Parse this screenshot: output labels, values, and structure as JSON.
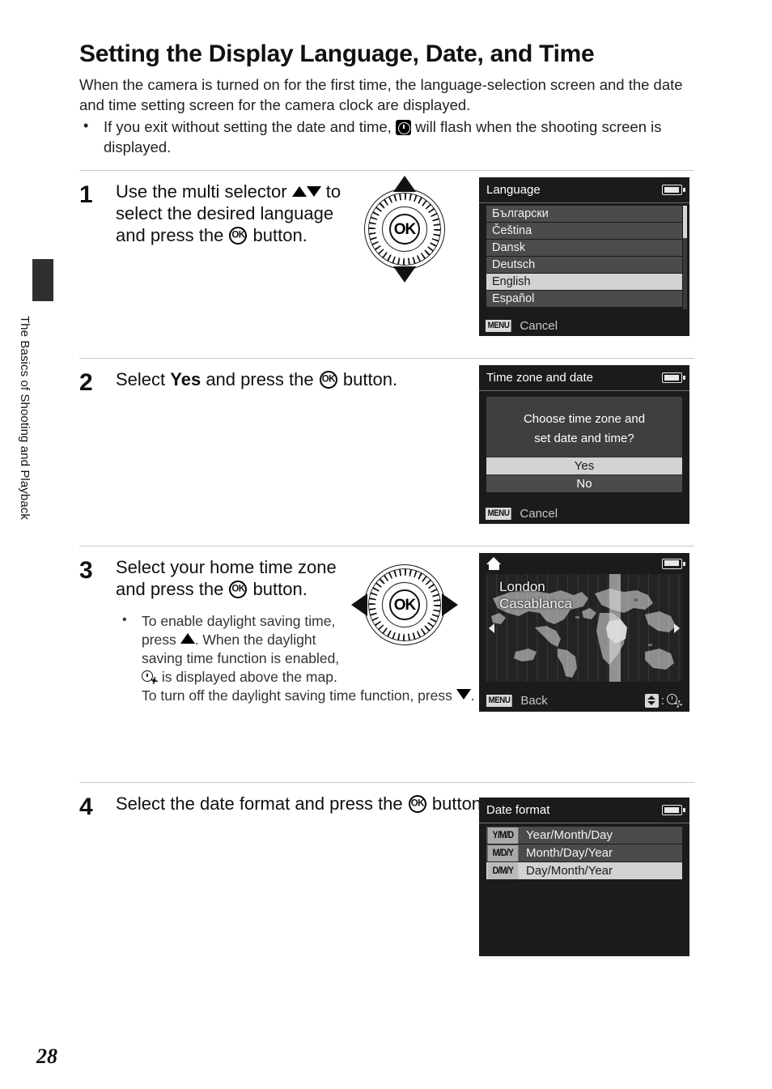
{
  "sidebar": {
    "chapter_label": "The Basics of Shooting and Playback"
  },
  "page": {
    "number": "28",
    "title": "Setting the Display Language, Date, and Time",
    "intro": "When the camera is turned on for the first time, the language-selection screen and the date and time setting screen for the camera clock are displayed.",
    "intro_bullet_pre": "If you exit without setting the date and time, ",
    "intro_bullet_post": " will flash when the shooting screen is displayed.",
    "bullet_marker": "•"
  },
  "steps": [
    {
      "number": "1",
      "text_pre": "Use the multi selector ",
      "text_mid": " to select the desired language and press the ",
      "text_post": " button.",
      "dial": {
        "arrows": "up-down",
        "ok_label": "OK"
      }
    },
    {
      "number": "2",
      "text_pre": "Select ",
      "bold": "Yes",
      "text_mid": " and press the ",
      "text_post": " button."
    },
    {
      "number": "3",
      "text_pre": "Select your home time zone and press the ",
      "text_post": " button.",
      "dial": {
        "arrows": "left-right",
        "ok_label": "OK"
      },
      "bullet_line1": "To enable daylight saving time, press ",
      "bullet_line2": ". When the daylight saving time function is enabled, ",
      "bullet_line3": " is displayed above the map.",
      "bullet_line4_pre": "To turn off the daylight saving time function, press ",
      "bullet_line4_post": "."
    },
    {
      "number": "4",
      "text_pre": "Select the date format and press the ",
      "text_post": " button."
    }
  ],
  "screens": {
    "language": {
      "title": "Language",
      "items": [
        {
          "label": "Български",
          "selected": false
        },
        {
          "label": "Čeština",
          "selected": false
        },
        {
          "label": "Dansk",
          "selected": false
        },
        {
          "label": "Deutsch",
          "selected": false
        },
        {
          "label": "English",
          "selected": true
        },
        {
          "label": "Español",
          "selected": false
        }
      ],
      "footer_badge": "MENU",
      "footer_label": "Cancel"
    },
    "time_zone_and_date": {
      "title": "Time zone and date",
      "question_line1": "Choose time zone and",
      "question_line2": "set date and time?",
      "options": [
        {
          "label": "Yes",
          "selected": true
        },
        {
          "label": "No",
          "selected": false
        }
      ],
      "footer_badge": "MENU",
      "footer_label": "Cancel"
    },
    "home_time_zone": {
      "city_line1": "London",
      "city_line2": "Casablanca",
      "footer_badge": "MENU",
      "footer_label": "Back"
    },
    "date_format": {
      "title": "Date format",
      "rows": [
        {
          "badge": "Y/M/D",
          "label": "Year/Month/Day",
          "selected": false
        },
        {
          "badge": "M/D/Y",
          "label": "Month/Day/Year",
          "selected": false
        },
        {
          "badge": "D/M/Y",
          "label": "Day/Month/Year",
          "selected": true
        }
      ]
    }
  }
}
